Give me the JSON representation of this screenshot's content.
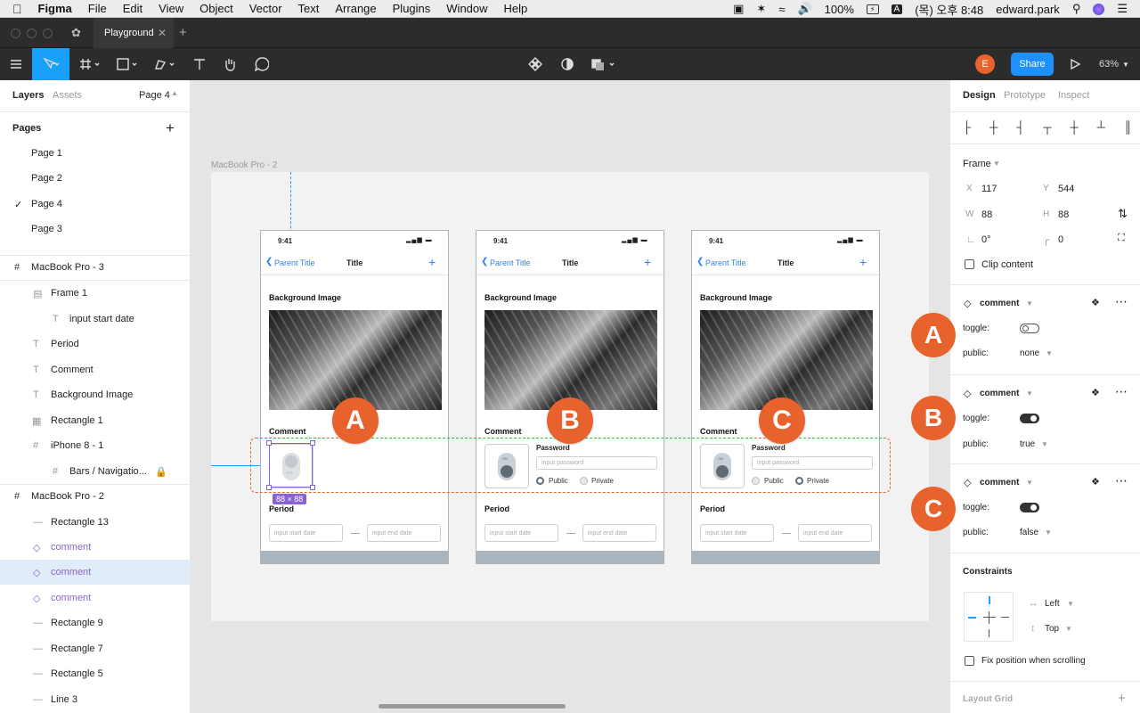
{
  "menubar": {
    "app": "Figma",
    "items": [
      "File",
      "Edit",
      "View",
      "Object",
      "Vector",
      "Text",
      "Arrange",
      "Plugins",
      "Window",
      "Help"
    ],
    "battery": "100%",
    "input_letter": "A",
    "clock": "(목) 오후 8:48",
    "user": "edward.park"
  },
  "tab": {
    "title": "Playground"
  },
  "toolbar": {
    "avatar_letter": "E",
    "share_label": "Share",
    "zoom": "63%"
  },
  "left": {
    "tabs": {
      "layers": "Layers",
      "assets": "Assets"
    },
    "page_selector": "Page 4",
    "pages_header": "Pages",
    "pages": [
      "Page 1",
      "Page 2",
      "Page 4",
      "Page 3"
    ],
    "layers": [
      "MacBook Pro - 3",
      "Frame 1",
      "input start date",
      "Period",
      "Comment",
      "Background Image",
      "Rectangle 1",
      "iPhone 8 - 1",
      "Bars / Navigatio...",
      "MacBook Pro - 2",
      "Rectangle 13",
      "comment",
      "comment",
      "comment",
      "Rectangle 9",
      "Rectangle 7",
      "Rectangle 5",
      "Line 3"
    ]
  },
  "canvas": {
    "frame_label": "MacBook Pro - 2",
    "size_badge": "88 × 88",
    "phones": [
      {
        "time": "9:41",
        "back": "Parent Title",
        "title": "Title",
        "bg_label": "Background Image",
        "comment_label": "Comment",
        "period_label": "Period",
        "start_ph": "input start date",
        "end_ph": "input end date",
        "badge": "A",
        "toggle_text": "OFF"
      },
      {
        "time": "9:41",
        "back": "Parent Title",
        "title": "Title",
        "bg_label": "Background Image",
        "comment_label": "Comment",
        "period_label": "Period",
        "start_ph": "input start date",
        "end_ph": "input end date",
        "badge": "B",
        "toggle_text": "ON",
        "password_label": "Password",
        "password_ph": "input password",
        "public": "Public",
        "private": "Private"
      },
      {
        "time": "9:41",
        "back": "Parent Title",
        "title": "Title",
        "bg_label": "Background Image",
        "comment_label": "Comment",
        "period_label": "Period",
        "start_ph": "input start date",
        "end_ph": "input end date",
        "badge": "C",
        "toggle_text": "ON",
        "password_label": "Password",
        "password_ph": "input password",
        "public": "Public",
        "private": "Private"
      }
    ]
  },
  "right": {
    "tabs": {
      "design": "Design",
      "prototype": "Prototype",
      "inspect": "Inspect"
    },
    "frame_label": "Frame",
    "fields": {
      "x_label": "X",
      "x": "117",
      "y_label": "Y",
      "y": "544",
      "w_label": "W",
      "w": "88",
      "h_label": "H",
      "h": "88",
      "rotation": "0°",
      "radius": "0"
    },
    "clip_content": "Clip content",
    "instances": [
      {
        "name": "comment",
        "badge": "A",
        "toggle_label": "toggle:",
        "public_label": "public:",
        "public_value": "none"
      },
      {
        "name": "comment",
        "badge": "B",
        "toggle_label": "toggle:",
        "public_label": "public:",
        "public_value": "true"
      },
      {
        "name": "comment",
        "badge": "C",
        "toggle_label": "toggle:",
        "public_label": "public:",
        "public_value": "false"
      }
    ],
    "constraints_title": "Constraints",
    "constraint_h": "Left",
    "constraint_v": "Top",
    "fix_position": "Fix position when scrolling",
    "layout_grid": "Layout Grid"
  },
  "colors": {
    "accent": "#e8622d",
    "figma_blue": "#18a0fb",
    "share_blue": "#1e90ff",
    "purple": "#8a63d2"
  }
}
